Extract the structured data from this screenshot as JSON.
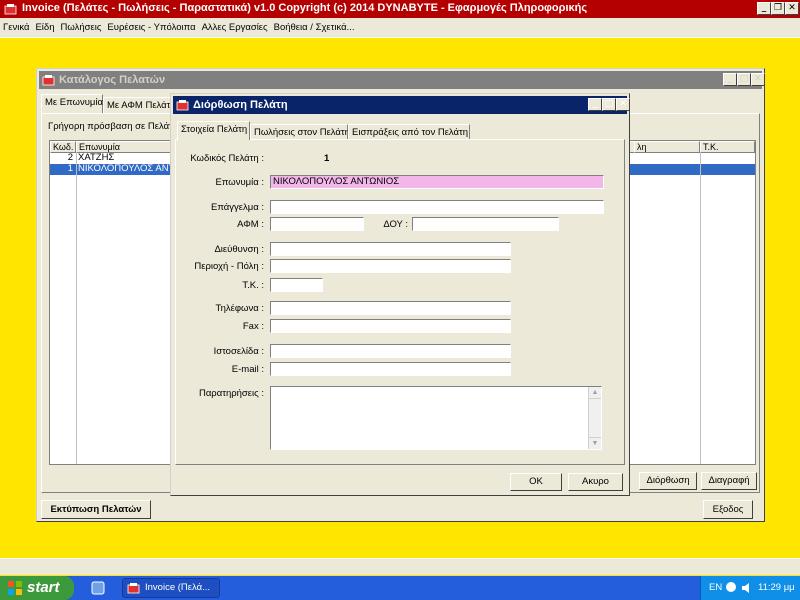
{
  "app": {
    "title": "Invoice (Πελάτες - Πωλήσεις - Παραστατικά)  v1.0   Copyright (c) 2014  DYNABYTE - Εφαρμογές Πληροφορικής"
  },
  "menu": {
    "items": [
      "Γενικά",
      "Είδη",
      "Πωλήσεις",
      "Ευρέσεις - Υπόλοιπα",
      "Αλλες Εργασίες",
      "Βοήθεια / Σχετικά..."
    ]
  },
  "customer_list": {
    "title": "Κατάλογος Πελατών",
    "tabs": [
      "Με Επωνυμία",
      "Με ΑΦΜ Πελάτη"
    ],
    "quick_access_label": "Γρήγορη πρόσβαση σε Πελάτη",
    "columns": [
      "Κωδ.",
      "Επωνυμία",
      "λη",
      "Τ.Κ."
    ],
    "rows": [
      {
        "code": "2",
        "name": "ΧΑΤΖΗΣ"
      },
      {
        "code": "1",
        "name": "ΝΙΚΟΛΟΠΟΥΛΟΣ ΑΝΤΩΝ"
      }
    ],
    "edit_button": "Διόρθωση",
    "delete_button": "Διαγραφή",
    "print_button": "Εκτύπωση Πελατών",
    "exit_button": "Εξοδος"
  },
  "edit_dialog": {
    "title": "Διόρθωση Πελάτη",
    "tabs": [
      "Στοιχεία Πελάτη",
      "Πωλήσεις στον Πελάτη",
      "Εισπράξεις από τον Πελάτη"
    ],
    "code_label": "Κωδικός Πελάτη :",
    "code_value": "1",
    "fields": {
      "name": {
        "label": "Επωνυμία :",
        "value": "ΝΙΚΟΛΟΠΟΥΛΟΣ ΑΝΤΩΝΙΟΣ"
      },
      "profession": {
        "label": "Επάγγελμα :",
        "value": ""
      },
      "afm": {
        "label": "ΑΦΜ :",
        "value": ""
      },
      "doy": {
        "label": "ΔΟΥ :",
        "value": ""
      },
      "address": {
        "label": "Διεύθυνση :",
        "value": ""
      },
      "area": {
        "label": "Περιοχή - Πόλη :",
        "value": ""
      },
      "zip": {
        "label": "Τ.Κ. :",
        "value": ""
      },
      "phones": {
        "label": "Τηλέφωνα :",
        "value": ""
      },
      "fax": {
        "label": "Fax :",
        "value": ""
      },
      "website": {
        "label": "Ιστοσελίδα :",
        "value": ""
      },
      "email": {
        "label": "E-mail :",
        "value": ""
      },
      "notes": {
        "label": "Παρατηρήσεις :",
        "value": ""
      }
    },
    "ok_button": "OK",
    "cancel_button": "Ακυρο"
  },
  "taskbar": {
    "start_label": "start",
    "task_label": "Invoice (Πελά...",
    "lang": "EN",
    "clock": "11:29 μμ"
  },
  "colors": {
    "main_title": "#B40000",
    "desktop": "#FFE600",
    "selection": "#316AC5",
    "name_field": "#F2B6E8",
    "taskbar": "#245EDC",
    "start": "#3C9A3C"
  }
}
